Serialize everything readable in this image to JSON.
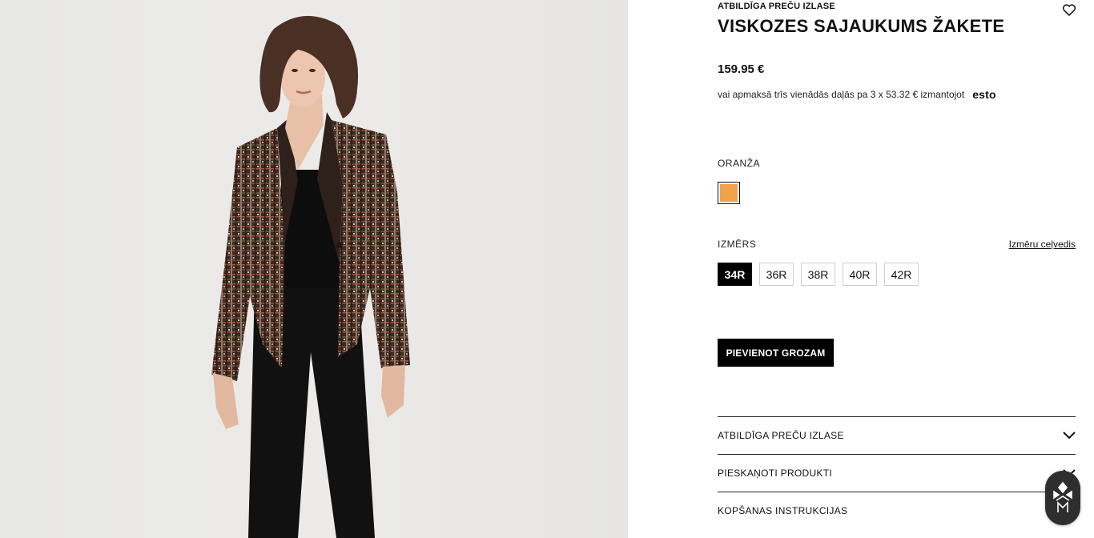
{
  "product": {
    "collection_label": "ATBILDĪGA PREČU IZLASE",
    "title": "VISKOZES SAJAUKUMS ŽAKETE",
    "price": "159.95 €",
    "installment_text": "vai apmaksā trīs vienādās daļās pa 3 x 53.32 € izmantojot",
    "installment_provider": "esto"
  },
  "color": {
    "label": "ORANŽA",
    "swatch_hex": "#f0a24c"
  },
  "size": {
    "label": "IZMĒRS",
    "guide_link": "Izmēru ceļvedis",
    "options": [
      "34R",
      "36R",
      "38R",
      "40R",
      "42R"
    ],
    "selected": "34R"
  },
  "cart": {
    "add_label": "PIEVIENOT GROZAM"
  },
  "accordion": [
    {
      "label": "ATBILDĪGA PREČU IZLASE"
    },
    {
      "label": "PIESKAŅOTI PRODUKTI"
    },
    {
      "label": "KOPŠANAS INSTRUKCIJAS"
    }
  ],
  "icons": {
    "wishlist": "heart-icon",
    "accordion_toggle": "chevron-down-icon",
    "chat": "chat-widget-icon"
  },
  "colors": {
    "primary": "#000000",
    "background": "#ffffff",
    "photo_background": "#e9e8e6"
  }
}
